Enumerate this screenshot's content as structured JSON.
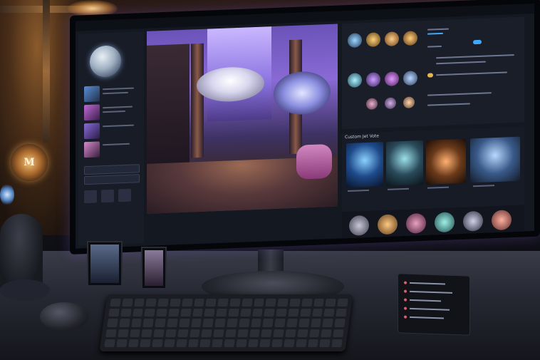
{
  "scene": {
    "description_hidden": "",
    "badge_letter": "M"
  },
  "screen": {
    "title_items": [
      "",
      "",
      "",
      ""
    ],
    "gallery_title": "Custom Jet Vote"
  },
  "colors": {
    "accent": "#3fa9ff",
    "screen_bg": "#141821",
    "glow": "#8a6ad6"
  },
  "icons": [
    "moon-image",
    "orb-thumbnail",
    "toggle",
    "keyboard",
    "mouse",
    "phone-notification"
  ]
}
